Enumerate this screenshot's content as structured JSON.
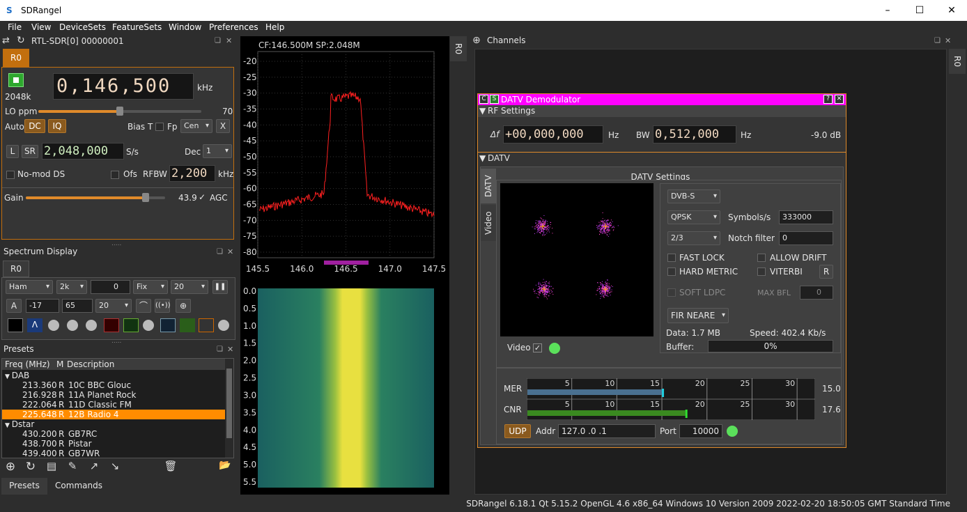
{
  "window": {
    "title": "SDRangel",
    "logo": "S",
    "min_icon": "minimize-icon",
    "max_icon": "maximize-icon",
    "close_icon": "close-icon"
  },
  "menu": [
    "File",
    "View",
    "DeviceSets",
    "FeatureSets",
    "Window",
    "Preferences",
    "Help"
  ],
  "device": {
    "name": "RTL-SDR[0] 00000001",
    "tab": "R0",
    "samplerate": "2048k",
    "freq": "0,146,500",
    "freq_unit": "kHz",
    "lo_label": "LO ppm",
    "lo_value": "70",
    "lo_fraction": 0.5,
    "auto_label": "Auto",
    "dc": "DC",
    "iq": "IQ",
    "biast": "Bias T",
    "fp": "Fp",
    "fp_select": "Cen",
    "x": "X",
    "l": "L",
    "sr": "SR",
    "sr_value": "2,048,000",
    "sr_unit": "S/s",
    "dec_label": "Dec",
    "dec_value": "1",
    "nomod": "No-mod DS",
    "ofs": "Ofs",
    "rfbw_label": "RFBW",
    "rfbw_value": "2,200",
    "rfbw_unit": "kHz",
    "gain_label": "Gain",
    "gain_value": "43.9",
    "agc": "AGC",
    "gain_fraction": 0.86
  },
  "spectrum_display": {
    "title": "Spectrum Display",
    "tab": "R0",
    "row1": {
      "window": "Ham",
      "fft": "2k",
      "ref": "0",
      "mode": "Fix",
      "avg": "20"
    },
    "row2": {
      "a": "A",
      "min": "-17",
      "range": "65",
      "val": "20"
    }
  },
  "presets": {
    "title": "Presets",
    "headers": [
      "Freq (MHz)",
      "M",
      "Description"
    ],
    "groups": [
      {
        "name": "DAB",
        "rows": [
          {
            "freq": "213.360",
            "m": "R",
            "desc": "10C BBC Glouc",
            "selected": false
          },
          {
            "freq": "216.928",
            "m": "R",
            "desc": "11A Planet Rock",
            "selected": false
          },
          {
            "freq": "222.064",
            "m": "R",
            "desc": "11D Classic FM",
            "selected": false
          },
          {
            "freq": "225.648",
            "m": "R",
            "desc": "12B Radio 4",
            "selected": true
          }
        ]
      },
      {
        "name": "Dstar",
        "rows": [
          {
            "freq": "430.200",
            "m": "R",
            "desc": "GB7RC",
            "selected": false
          },
          {
            "freq": "438.700",
            "m": "R",
            "desc": "Pistar",
            "selected": false
          },
          {
            "freq": "439.400",
            "m": "R",
            "desc": "GB7WR",
            "selected": false
          }
        ]
      }
    ],
    "tabs": [
      "Presets",
      "Commands"
    ]
  },
  "spectrum": {
    "header": "CF:146.500M SP:2.048M",
    "y_ticks": [
      "-20",
      "-25",
      "-30",
      "-35",
      "-40",
      "-45",
      "-50",
      "-55",
      "-60",
      "-65",
      "-70",
      "-75",
      "-80"
    ],
    "x_ticks": [
      "145.5",
      "146.0",
      "146.5",
      "147.0",
      "147.5"
    ],
    "wf_ticks": [
      "0.0",
      "0.5",
      "1.0",
      "1.5",
      "2.0",
      "2.5",
      "3.0",
      "3.5",
      "4.0",
      "4.5",
      "5.0",
      "5.5"
    ],
    "tab": "R0"
  },
  "channels": {
    "title": "Channels",
    "tab": "R0"
  },
  "datv": {
    "title": "DATV Demodulator",
    "c": "C",
    "s": "S",
    "help": "?",
    "rf_section": "RF Settings",
    "df_label": "Δf",
    "df_value": "+00,000,000",
    "df_unit": "Hz",
    "bw_label": "BW",
    "bw_value": "0,512,000",
    "bw_unit": "Hz",
    "level": "-9.0 dB",
    "datv_section": "DATV",
    "settings_title": "DATV Settings",
    "tabs": [
      "DATV",
      "Video"
    ],
    "standard": "DVB-S",
    "modulation": "QPSK",
    "symbols_label": "Symbols/s",
    "symbols_value": "333000",
    "fec": "2/3",
    "notch_label": "Notch filter",
    "notch_value": "0",
    "fast_lock": "FAST LOCK",
    "allow_drift": "ALLOW DRIFT",
    "hard_metric": "HARD METRIC",
    "viterbi": "VITERBI",
    "r": "R",
    "soft_ldpc": "SOFT LDPC",
    "max_bfl": "MAX BFL",
    "max_bfl_value": "0",
    "filter": "FIR NEARE",
    "data": "Data: 1.7 MB",
    "speed": "Speed: 402.4 Kb/s",
    "buffer_label": "Buffer:",
    "buffer_value": "0%",
    "buffer_fraction": 0,
    "video_label": "Video",
    "mer_label": "MER",
    "mer_value": "15.0",
    "cnr_label": "CNR",
    "cnr_value": "17.6",
    "meter_ticks": [
      "5",
      "10",
      "15",
      "20",
      "25",
      "30"
    ],
    "udp": "UDP",
    "addr_label": "Addr",
    "addr_value": "127.0 .0 .1",
    "port_label": "Port",
    "port_value": "10000"
  },
  "status": "SDRangel 6.18.1 Qt 5.15.2 OpenGL 4.6 x86_64 Windows 10 Version 2009  2022-02-20 18:50:05 GMT Standard Time"
}
